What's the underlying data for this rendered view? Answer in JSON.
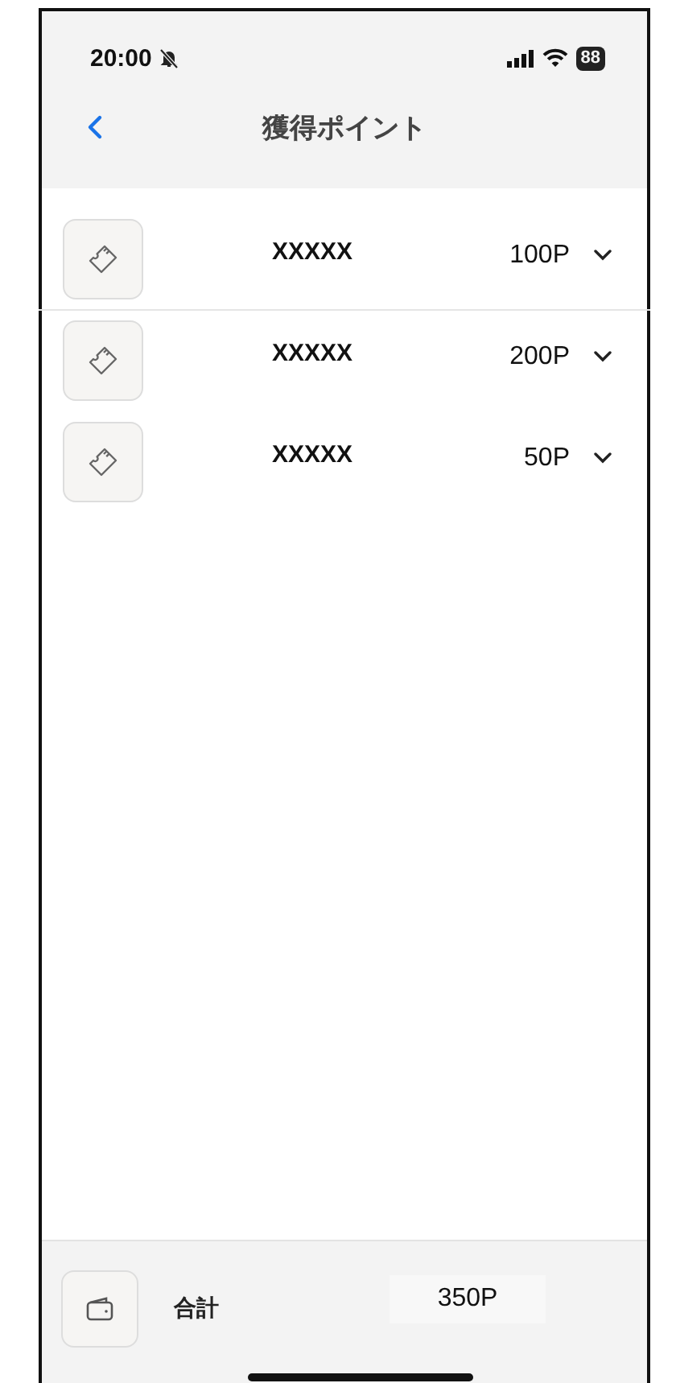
{
  "status_bar": {
    "time": "20:00",
    "battery": "88"
  },
  "nav": {
    "title": "獲得ポイント"
  },
  "items": [
    {
      "name": "XXXXX",
      "points": "100P"
    },
    {
      "name": "XXXXX",
      "points": "200P"
    },
    {
      "name": "XXXXX",
      "points": "50P"
    }
  ],
  "footer": {
    "label": "合計",
    "total": "350P"
  }
}
